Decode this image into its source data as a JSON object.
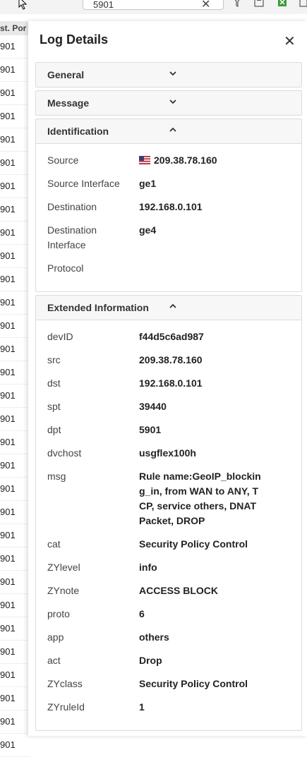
{
  "toolbar": {
    "search_value": "5901",
    "clear_icon": "close-icon",
    "icons": [
      "filter-icon",
      "save-icon",
      "export-icon",
      "columns-icon"
    ]
  },
  "background_list": {
    "header": "st. Por",
    "rows": [
      "901",
      "901",
      "901",
      "901",
      "901",
      "901",
      "901",
      "901",
      "901",
      "901",
      "901",
      "901",
      "901",
      "901",
      "901",
      "901",
      "901",
      "901",
      "901",
      "901",
      "901",
      "901",
      "901",
      "901",
      "901",
      "901",
      "901",
      "901",
      "901",
      "901",
      "901"
    ]
  },
  "panel": {
    "title": "Log Details",
    "close_icon": "close-icon"
  },
  "sections": {
    "general": {
      "title": "General",
      "state": "collapsed"
    },
    "message": {
      "title": "Message",
      "state": "collapsed"
    },
    "identification": {
      "title": "Identification",
      "state": "expanded",
      "rows": [
        {
          "key": "Source",
          "value": "209.38.78.160",
          "flag": "us-flag-icon"
        },
        {
          "key": "Source Interface",
          "value": "ge1"
        },
        {
          "key": "Destination",
          "value": "192.168.0.101"
        },
        {
          "key": "Destination Interface",
          "value": "ge4"
        },
        {
          "key": "Protocol",
          "value": ""
        }
      ]
    },
    "extended": {
      "title": "Extended Information",
      "state": "expanded",
      "rows": [
        {
          "key": "devID",
          "value": "f44d5c6ad987"
        },
        {
          "key": "src",
          "value": "209.38.78.160"
        },
        {
          "key": "dst",
          "value": "192.168.0.101"
        },
        {
          "key": "spt",
          "value": "39440"
        },
        {
          "key": "dpt",
          "value": "5901"
        },
        {
          "key": "dvchost",
          "value": "usgflex100h"
        },
        {
          "key": "msg",
          "value": "Rule name:GeoIP_blocking_in, from WAN to ANY, TCP, service others, DNAT Packet, DROP"
        },
        {
          "key": "cat",
          "value": "Security Policy Control"
        },
        {
          "key": "ZYlevel",
          "value": "info"
        },
        {
          "key": "ZYnote",
          "value": "ACCESS BLOCK"
        },
        {
          "key": "proto",
          "value": "6"
        },
        {
          "key": "app",
          "value": "others"
        },
        {
          "key": "act",
          "value": "Drop"
        },
        {
          "key": "ZYclass",
          "value": "Security Policy Control"
        },
        {
          "key": "ZYruleId",
          "value": "1"
        }
      ]
    }
  },
  "colors": {
    "header_bg": "#f7f7f7",
    "border": "#dcdcdc",
    "text_dark": "#222222",
    "label": "#444444"
  }
}
